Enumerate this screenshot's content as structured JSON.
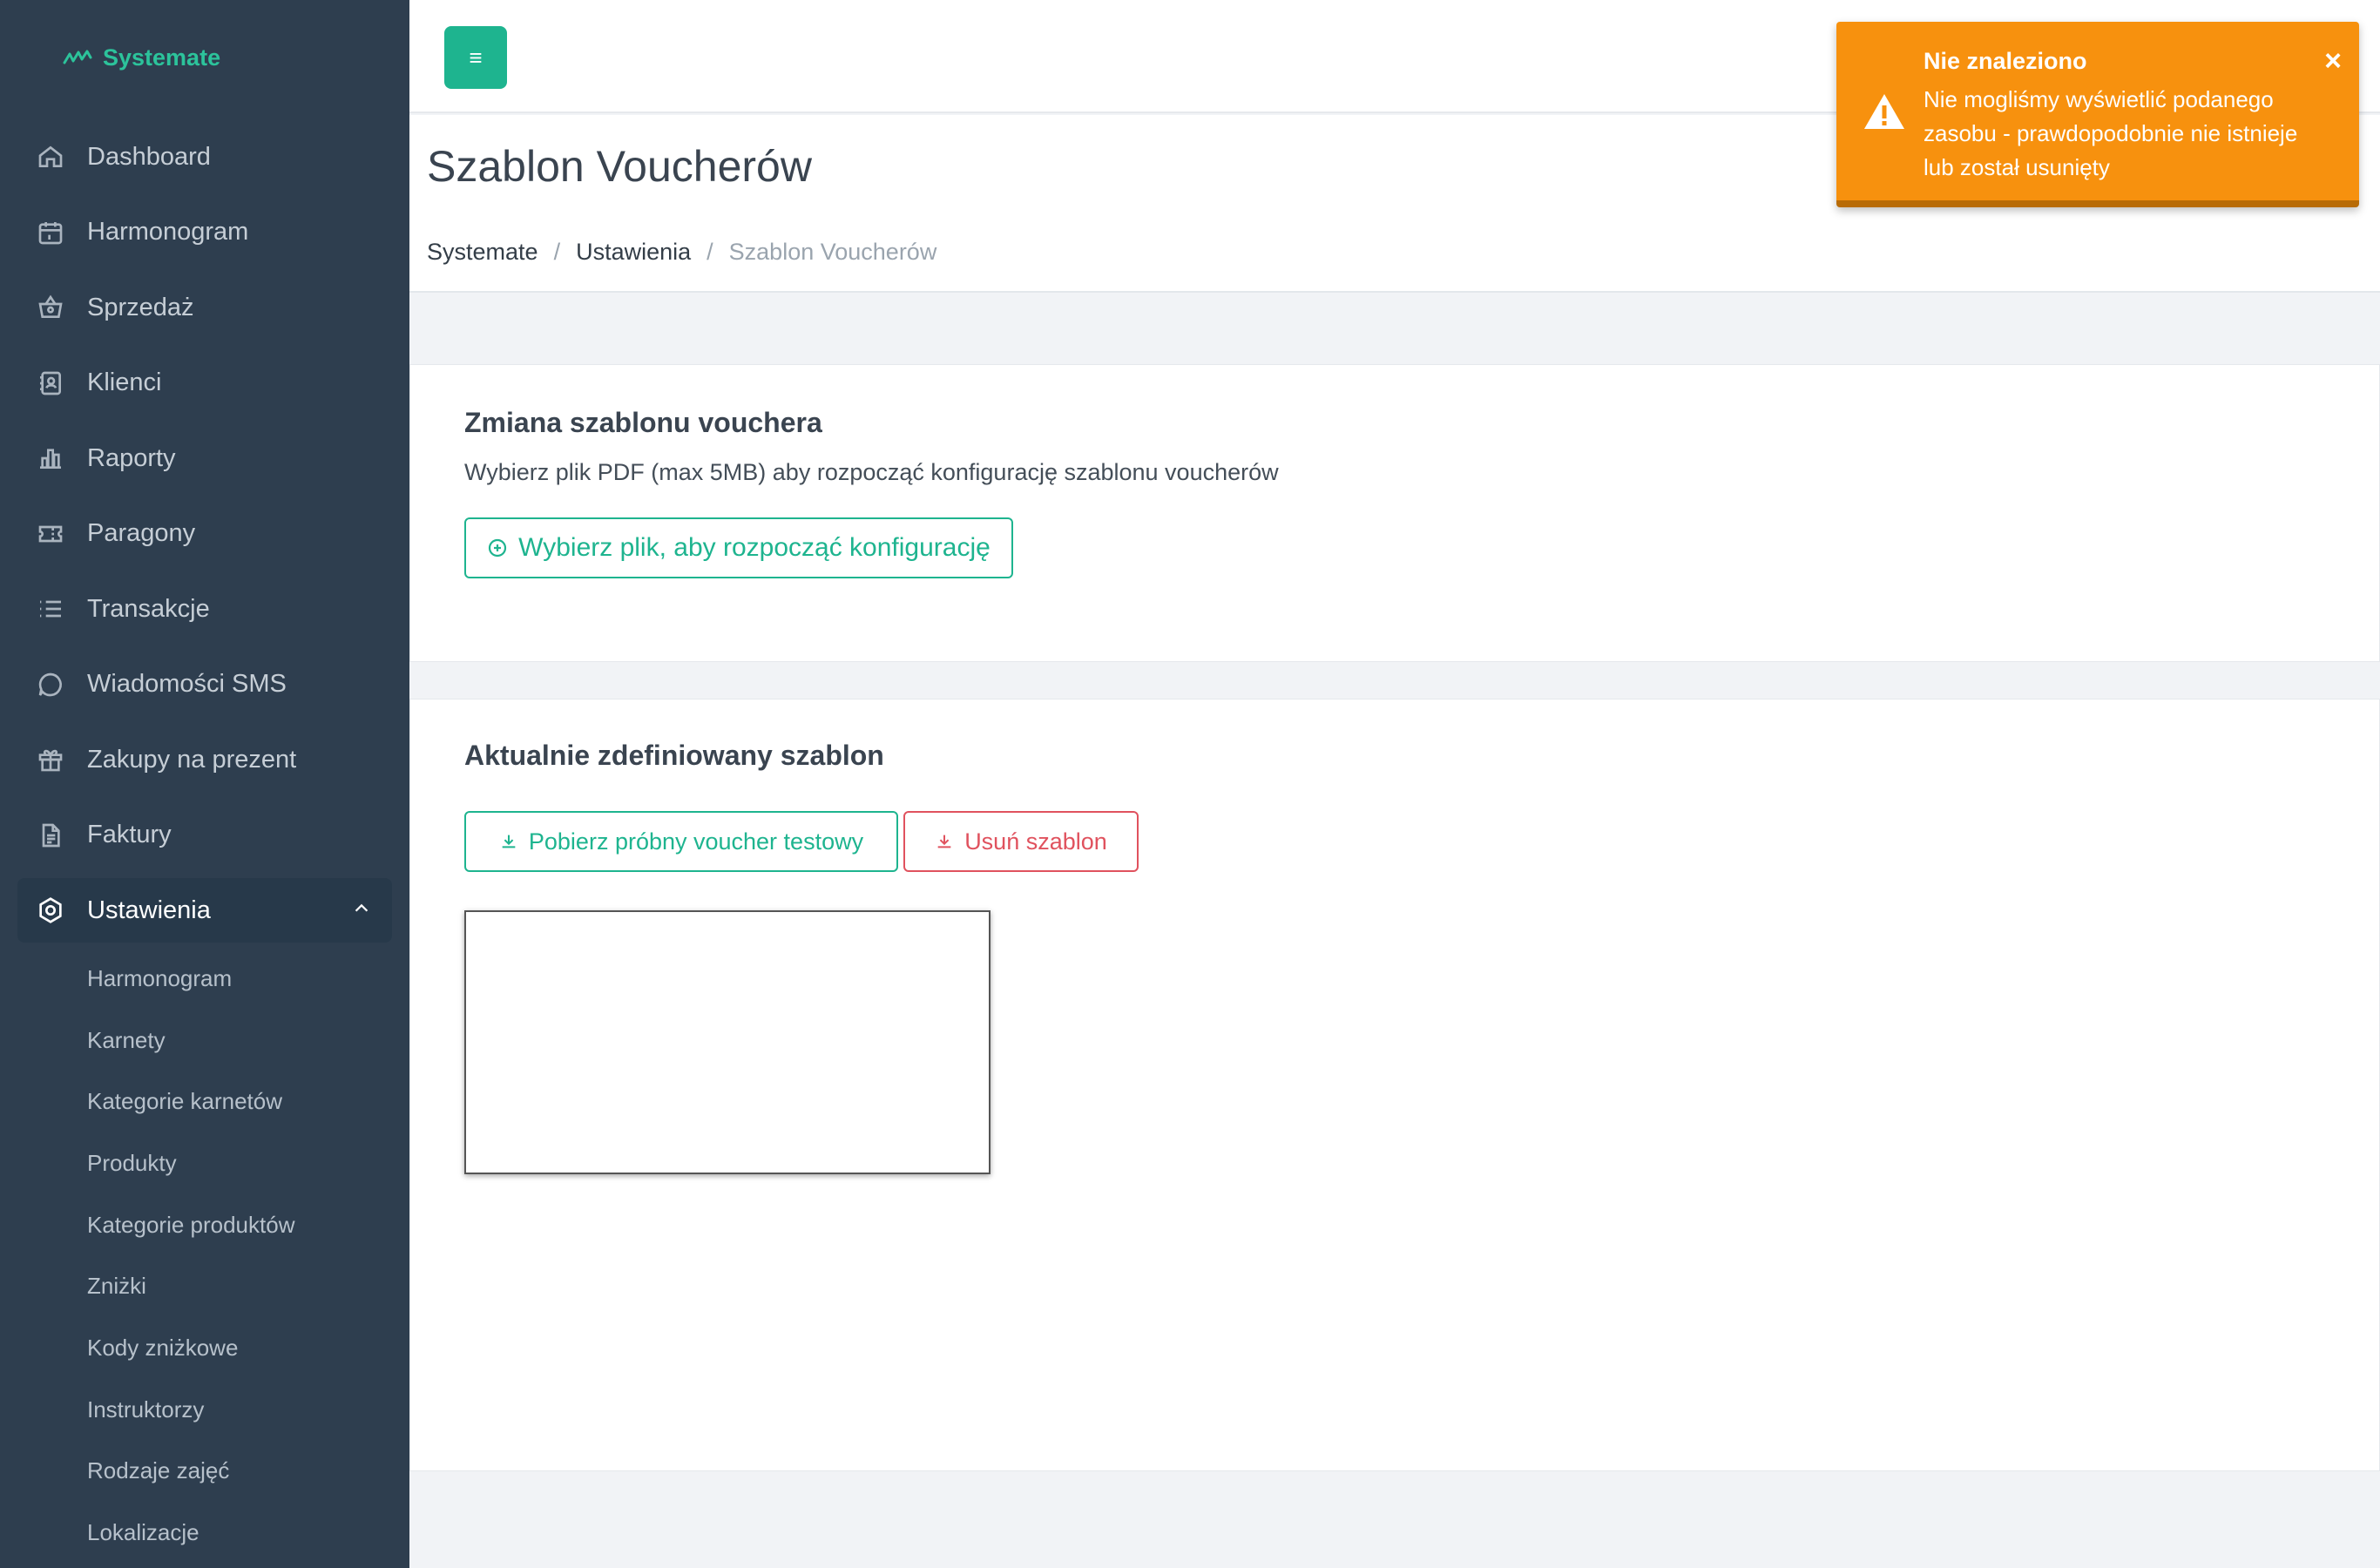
{
  "app": {
    "name": "Systemate"
  },
  "sidebar": {
    "items": [
      {
        "label": "Dashboard",
        "icon": "home-icon"
      },
      {
        "label": "Harmonogram",
        "icon": "calendar-icon"
      },
      {
        "label": "Sprzedaż",
        "icon": "basket-icon"
      },
      {
        "label": "Klienci",
        "icon": "contacts-icon"
      },
      {
        "label": "Raporty",
        "icon": "bar-chart-icon"
      },
      {
        "label": "Paragony",
        "icon": "ticket-icon"
      },
      {
        "label": "Transakcje",
        "icon": "list-icon"
      },
      {
        "label": "Wiadomości SMS",
        "icon": "chat-icon"
      },
      {
        "label": "Zakupy na prezent",
        "icon": "gift-icon"
      },
      {
        "label": "Faktury",
        "icon": "document-icon"
      }
    ],
    "active": {
      "label": "Ustawienia",
      "icon": "settings-icon"
    },
    "subitems": [
      "Harmonogram",
      "Karnety",
      "Kategorie karnetów",
      "Produkty",
      "Kategorie produktów",
      "Zniżki",
      "Kody zniżkowe",
      "Instruktorzy",
      "Rodzaje zajęć",
      "Lokalizacje"
    ]
  },
  "header": {
    "menu_icon": "≡",
    "title": "Szablon Voucherów",
    "breadcrumb": [
      "Systemate",
      "Ustawienia",
      "Szablon Voucherów"
    ],
    "breadcrumb_sep": "/"
  },
  "card_change": {
    "title": "Zmiana szablonu vouchera",
    "description": "Wybierz plik PDF (max 5MB) aby rozpocząć konfigurację szablonu voucherów",
    "choose_button": "Wybierz plik, aby rozpocząć konfigurację"
  },
  "card_current": {
    "title": "Aktualnie zdefiniowany szablon",
    "download_button": "Pobierz próbny voucher testowy",
    "delete_button": "Usuń szablon"
  },
  "toast": {
    "title": "Nie znaleziono",
    "message": "Nie mogliśmy wyświetlić podanego zasobu - prawdopodobnie nie istnieje lub został usunięty",
    "close": "×",
    "color": "#f7910e"
  },
  "colors": {
    "sidebar_bg": "#2e3e4f",
    "accent": "#1eb48f",
    "danger": "#e0525e"
  }
}
